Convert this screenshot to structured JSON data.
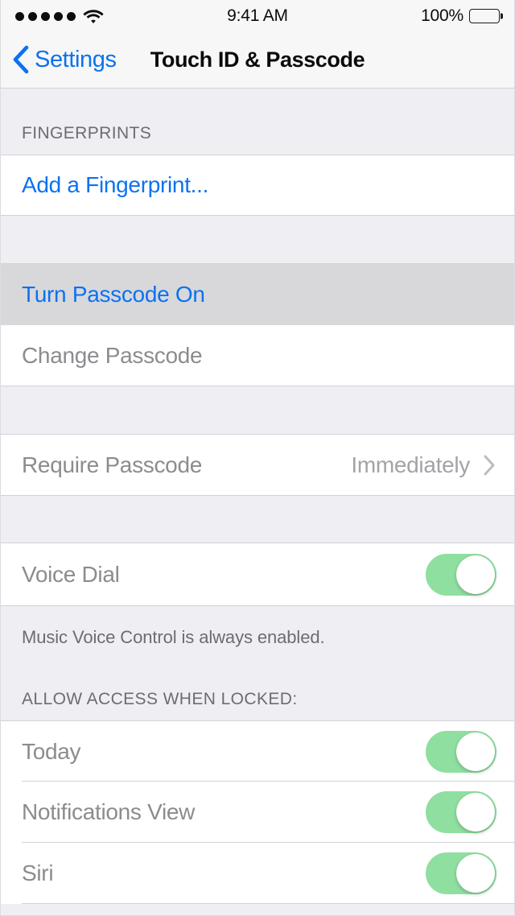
{
  "status_bar": {
    "signal_dots": 5,
    "signal_icon": "signal-dots",
    "wifi_icon": "wifi-icon",
    "time": "9:41 AM",
    "battery_percent": "100%",
    "battery_icon": "battery-full-icon",
    "battery_level": 100
  },
  "nav": {
    "back_icon": "chevron-left-icon",
    "back_label": "Settings",
    "title": "Touch ID & Passcode"
  },
  "sections": {
    "fingerprints": {
      "header": "FINGERPRINTS",
      "rows": [
        {
          "label": "Add a Fingerprint...",
          "style": "action",
          "name": "add-a-fingerprint"
        }
      ]
    },
    "passcode": {
      "rows": [
        {
          "label": "Turn Passcode On",
          "style": "action",
          "highlighted": true,
          "name": "turn-passcode-on"
        },
        {
          "label": "Change Passcode",
          "style": "disabled",
          "highlighted": false,
          "name": "change-passcode"
        }
      ]
    },
    "require": {
      "rows": [
        {
          "label": "Require Passcode",
          "value": "Immediately",
          "disclosure_icon": "chevron-right-icon",
          "name": "require-passcode"
        }
      ]
    },
    "voice": {
      "rows": [
        {
          "label": "Voice Dial",
          "toggle": "on",
          "name": "voice-dial"
        }
      ],
      "footer": "Music Voice Control is always enabled."
    },
    "allow_access": {
      "header": "ALLOW ACCESS WHEN LOCKED:",
      "rows": [
        {
          "label": "Today",
          "toggle": "on",
          "name": "today"
        },
        {
          "label": "Notifications View",
          "toggle": "on",
          "name": "notifications-view"
        },
        {
          "label": "Siri",
          "toggle": "on",
          "name": "siri"
        }
      ]
    }
  },
  "colors": {
    "accent_blue": "#0b72f0",
    "toggle_on_green": "#8fdfa0",
    "group_background": "#efeef3",
    "cell_background": "#ffffff",
    "highlight_background": "#d8d8da",
    "separator": "#d2d1d6",
    "label_gray": "#8c8c90",
    "secondary_gray": "#6c6c72"
  }
}
